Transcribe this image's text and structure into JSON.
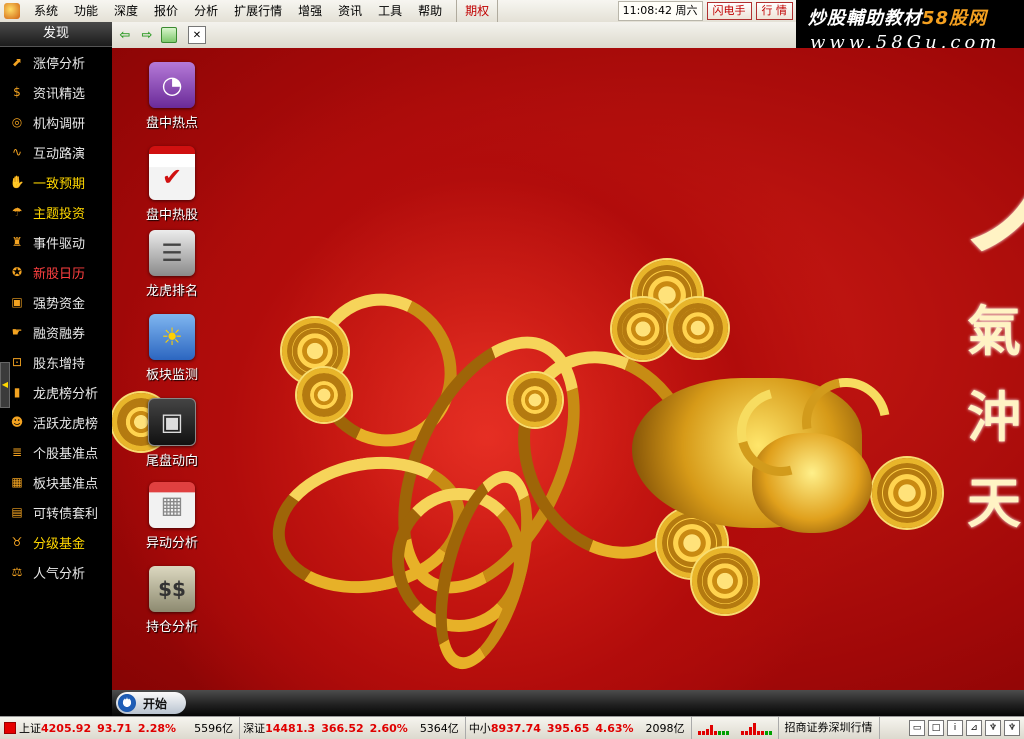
{
  "menu": {
    "items": [
      "系统",
      "功能",
      "深度",
      "报价",
      "分析",
      "扩展行情",
      "增强",
      "资讯",
      "工具",
      "帮助"
    ],
    "highlight": "期权",
    "time": "11:08:42 周六",
    "buttons": [
      "闪电手",
      "行 情"
    ]
  },
  "watermark": {
    "title_part1": "炒股輔助教材",
    "title_part2": "58股网",
    "url": "www.58Gu.com"
  },
  "sidebar": {
    "title": "发现",
    "items": [
      {
        "label": "涨停分析",
        "icon": "rising-chart-icon",
        "color": "white"
      },
      {
        "label": "资讯精选",
        "icon": "coin-icon",
        "color": "white"
      },
      {
        "label": "机构调研",
        "icon": "target-icon",
        "color": "white"
      },
      {
        "label": "互动路演",
        "icon": "line-chart-icon",
        "color": "white"
      },
      {
        "label": "一致预期",
        "icon": "handshake-icon",
        "color": "yellow"
      },
      {
        "label": "主题投资",
        "icon": "umbrella-icon",
        "color": "yellow"
      },
      {
        "label": "事件驱动",
        "icon": "money-bag-icon",
        "color": "white"
      },
      {
        "label": "新股日历",
        "icon": "award-icon",
        "color": "red"
      },
      {
        "label": "强势资金",
        "icon": "briefcase-icon",
        "color": "white"
      },
      {
        "label": "融资融券",
        "icon": "hand-money-icon",
        "color": "white"
      },
      {
        "label": "股东增持",
        "icon": "dollar-doc-icon",
        "color": "white"
      },
      {
        "label": "龙虎榜分析",
        "icon": "bar-chart-icon",
        "color": "white"
      },
      {
        "label": "活跃龙虎榜",
        "icon": "person-icon",
        "color": "white"
      },
      {
        "label": "个股基准点",
        "icon": "stack-icon",
        "color": "white"
      },
      {
        "label": "板块基准点",
        "icon": "blocks-icon",
        "color": "white"
      },
      {
        "label": "可转债套利",
        "icon": "wallet-icon",
        "color": "white"
      },
      {
        "label": "分级基金",
        "icon": "piggy-bank-icon",
        "color": "yellow"
      },
      {
        "label": "人气分析",
        "icon": "scale-icon",
        "color": "white"
      }
    ]
  },
  "desktop": {
    "icons": [
      {
        "label": "盘中热点",
        "icon": "gauge-icon",
        "symbol": "◔"
      },
      {
        "label": "盘中热股",
        "icon": "checkmark-icon",
        "symbol": "✔"
      },
      {
        "label": "龙虎排名",
        "icon": "database-icon",
        "symbol": "☰"
      },
      {
        "label": "板块监测",
        "icon": "weather-sun-icon",
        "symbol": "☀"
      },
      {
        "label": "尾盘动向",
        "icon": "map-icon",
        "symbol": "▣"
      },
      {
        "label": "异动分析",
        "icon": "calendar-icon",
        "symbol": "▦"
      },
      {
        "label": "持仓分析",
        "icon": "dollar-icon",
        "symbol": "$$"
      }
    ],
    "calligraphy": "氣沖天"
  },
  "taskbar": {
    "start_label": "开始"
  },
  "status": {
    "indices": [
      {
        "name": "上证",
        "value": "4205.92",
        "change": "93.71",
        "pct": "2.28%",
        "volume": "5596亿"
      },
      {
        "name": "深证",
        "value": "14481.3",
        "change": "366.52",
        "pct": "2.60%",
        "volume": "5364亿"
      },
      {
        "name": "中小",
        "value": "8937.74",
        "change": "395.65",
        "pct": "4.63%",
        "volume": "2098亿"
      }
    ],
    "broker": "招商证券深圳行情"
  },
  "colors": {
    "accent_red": "#e00000",
    "gold": "#e7b128",
    "background_red": "#b10c0b"
  }
}
